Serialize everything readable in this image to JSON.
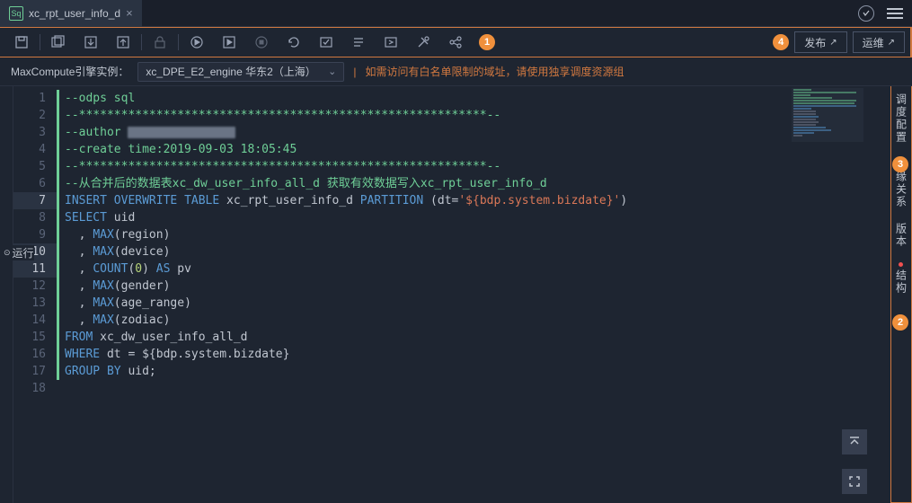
{
  "tab": {
    "icon_label": "Sq",
    "title": "xc_rpt_user_info_d"
  },
  "toolbar_buttons": [
    "save",
    "save-all",
    "import",
    "export",
    "lock",
    "run",
    "run-selected",
    "stop",
    "reload",
    "check",
    "format",
    "indent",
    "settings",
    "share"
  ],
  "badges": {
    "toolbar_left": "1",
    "toolbar_right": "4",
    "side_upper": "3",
    "side_lower": "2"
  },
  "publish": {
    "publish": "发布",
    "ops": "运维"
  },
  "engine": {
    "label": "MaxCompute引擎实例：",
    "value": "xc_DPE_E2_engine 华东2（上海）",
    "warning": "如需访问有白名单限制的域址，请使用独享调度资源组"
  },
  "run_tag": "运行",
  "sidepanel": {
    "schedule": "调度配置",
    "lineage": "血缘关系",
    "versions": "版本",
    "structure": "结构"
  },
  "code_lines": [
    {
      "n": 1,
      "changed": true,
      "html": "<span class='c-comment'>--odps sql</span>"
    },
    {
      "n": 2,
      "changed": true,
      "html": "<span class='c-comment'>--**********************************************************--</span>"
    },
    {
      "n": 3,
      "changed": true,
      "html": "<span class='c-comment'>--author </span><span class='smudge'></span>"
    },
    {
      "n": 4,
      "changed": true,
      "html": "<span class='c-comment'>--create time:2019-09-03 18:05:45</span>"
    },
    {
      "n": 5,
      "changed": true,
      "html": "<span class='c-comment'>--**********************************************************--</span>"
    },
    {
      "n": 6,
      "changed": true,
      "html": "<span class='c-comment'>--从合并后的数据表xc_dw_user_info_all_d 获取有效数据写入xc_rpt_user_info_d</span>"
    },
    {
      "n": 7,
      "changed": true,
      "hl": true,
      "html": "<span class='c-keyword'>INSERT</span> <span class='c-keyword'>OVERWRITE</span> <span class='c-keyword'>TABLE</span> <span class='c-plain'>xc_rpt_user_info_d</span> <span class='c-keyword'>PARTITION</span> <span class='c-plain'>(dt=</span><span class='c-str'>'${bdp.system.bizdate}'</span><span class='c-plain'>)</span>"
    },
    {
      "n": 8,
      "changed": true,
      "html": "<span class='c-keyword'>SELECT</span> <span class='c-plain'>uid</span>"
    },
    {
      "n": 9,
      "changed": true,
      "html": "  <span class='c-plain'>,</span> <span class='c-func'>MAX</span><span class='c-plain'>(region)</span>"
    },
    {
      "n": 10,
      "changed": true,
      "hl": true,
      "html": "  <span class='c-plain'>,</span> <span class='c-func'>MAX</span><span class='c-plain'>(device)</span>"
    },
    {
      "n": 11,
      "changed": true,
      "hl": true,
      "html": "  <span class='c-plain'>,</span> <span class='c-func'>COUNT</span><span class='c-plain'>(</span><span class='c-num'>0</span><span class='c-plain'>) </span><span class='c-keyword'>AS</span><span class='c-plain'> pv</span>"
    },
    {
      "n": 12,
      "changed": true,
      "html": "  <span class='c-plain'>,</span> <span class='c-func'>MAX</span><span class='c-plain'>(gender)</span>"
    },
    {
      "n": 13,
      "changed": true,
      "html": "  <span class='c-plain'>,</span> <span class='c-func'>MAX</span><span class='c-plain'>(age_range)</span>"
    },
    {
      "n": 14,
      "changed": true,
      "html": "  <span class='c-plain'>,</span> <span class='c-func'>MAX</span><span class='c-plain'>(zodiac)</span>"
    },
    {
      "n": 15,
      "changed": true,
      "html": "<span class='c-keyword'>FROM</span> <span class='c-plain'>xc_dw_user_info_all_d</span>"
    },
    {
      "n": 16,
      "changed": true,
      "html": "<span class='c-keyword'>WHERE</span> <span class='c-plain'>dt = ${bdp.system.bizdate}</span>"
    },
    {
      "n": 17,
      "changed": true,
      "html": "<span class='c-keyword'>GROUP</span> <span class='c-keyword'>BY</span> <span class='c-plain'>uid;</span>"
    },
    {
      "n": 18,
      "changed": false,
      "html": ""
    }
  ]
}
